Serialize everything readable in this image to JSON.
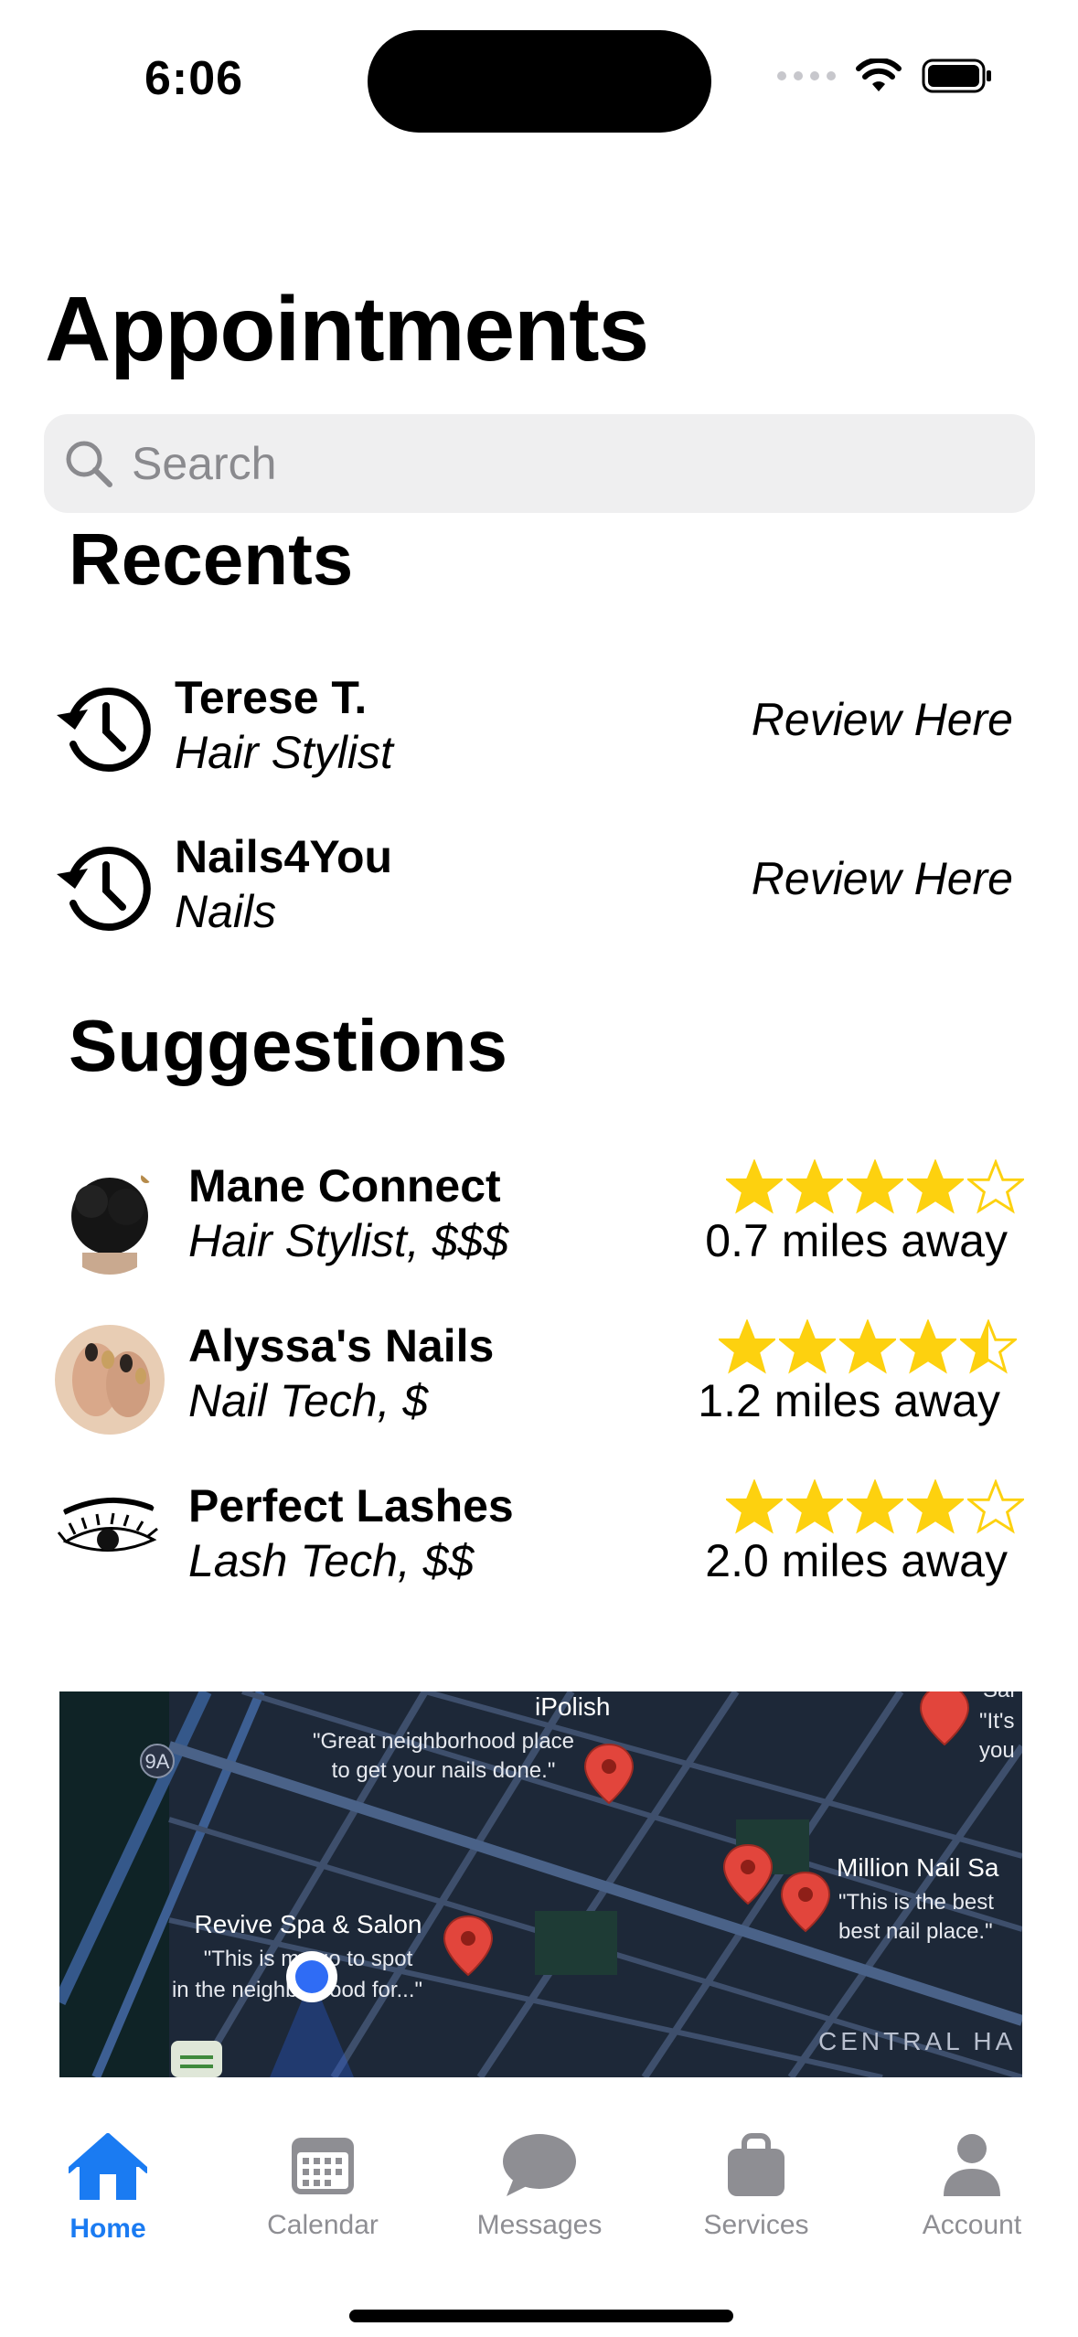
{
  "status": {
    "time": "6:06"
  },
  "page": {
    "title": "Appointments"
  },
  "search": {
    "placeholder": "Search"
  },
  "recents": {
    "heading": "Recents",
    "items": [
      {
        "name": "Terese T.",
        "type": "Hair Stylist",
        "action": "Review Here",
        "icon": "history-icon"
      },
      {
        "name": "Nails4You",
        "type": "Nails",
        "action": "Review Here",
        "icon": "history-icon"
      }
    ]
  },
  "suggestions": {
    "heading": "Suggestions",
    "items": [
      {
        "name": "Mane Connect",
        "detail": "Hair Stylist, $$$",
        "rating": 4,
        "distance": "0.7 miles away",
        "avatar": "afro-puff-photo"
      },
      {
        "name": "Alyssa's Nails",
        "detail": "Nail Tech, $",
        "rating": 4.5,
        "distance": "1.2 miles away",
        "avatar": "manicured-hands-photo"
      },
      {
        "name": "Perfect Lashes",
        "detail": "Lash Tech, $$",
        "rating": 4,
        "distance": "2.0 miles away",
        "avatar": "eyelash-drawing"
      }
    ]
  },
  "map": {
    "places": [
      {
        "name": "iPolish",
        "quote": "\"Great neighborhood place",
        "quote2": "to get your nails done.\""
      },
      {
        "name": "Million Nail Sa",
        "quote": "\"This is the best",
        "quote2": "best nail place.\""
      },
      {
        "name": "Revive Spa & Salon",
        "quote": "\"This is my go to spot",
        "quote2": "in the neighborhood for...\""
      },
      {
        "name": "Sal",
        "quote": "\"It's",
        "quote2": "you"
      }
    ],
    "route_label": "9A",
    "district": "CENTRAL HA"
  },
  "tabbar": {
    "tabs": [
      {
        "label": "Home",
        "active": true
      },
      {
        "label": "Calendar"
      },
      {
        "label": "Messages"
      },
      {
        "label": "Services"
      },
      {
        "label": "Account"
      }
    ]
  },
  "colors": {
    "accent": "#1a7bf2",
    "star": "#fdd10f",
    "pin": "#e2453c",
    "map_bg": "#1e2a3b"
  }
}
